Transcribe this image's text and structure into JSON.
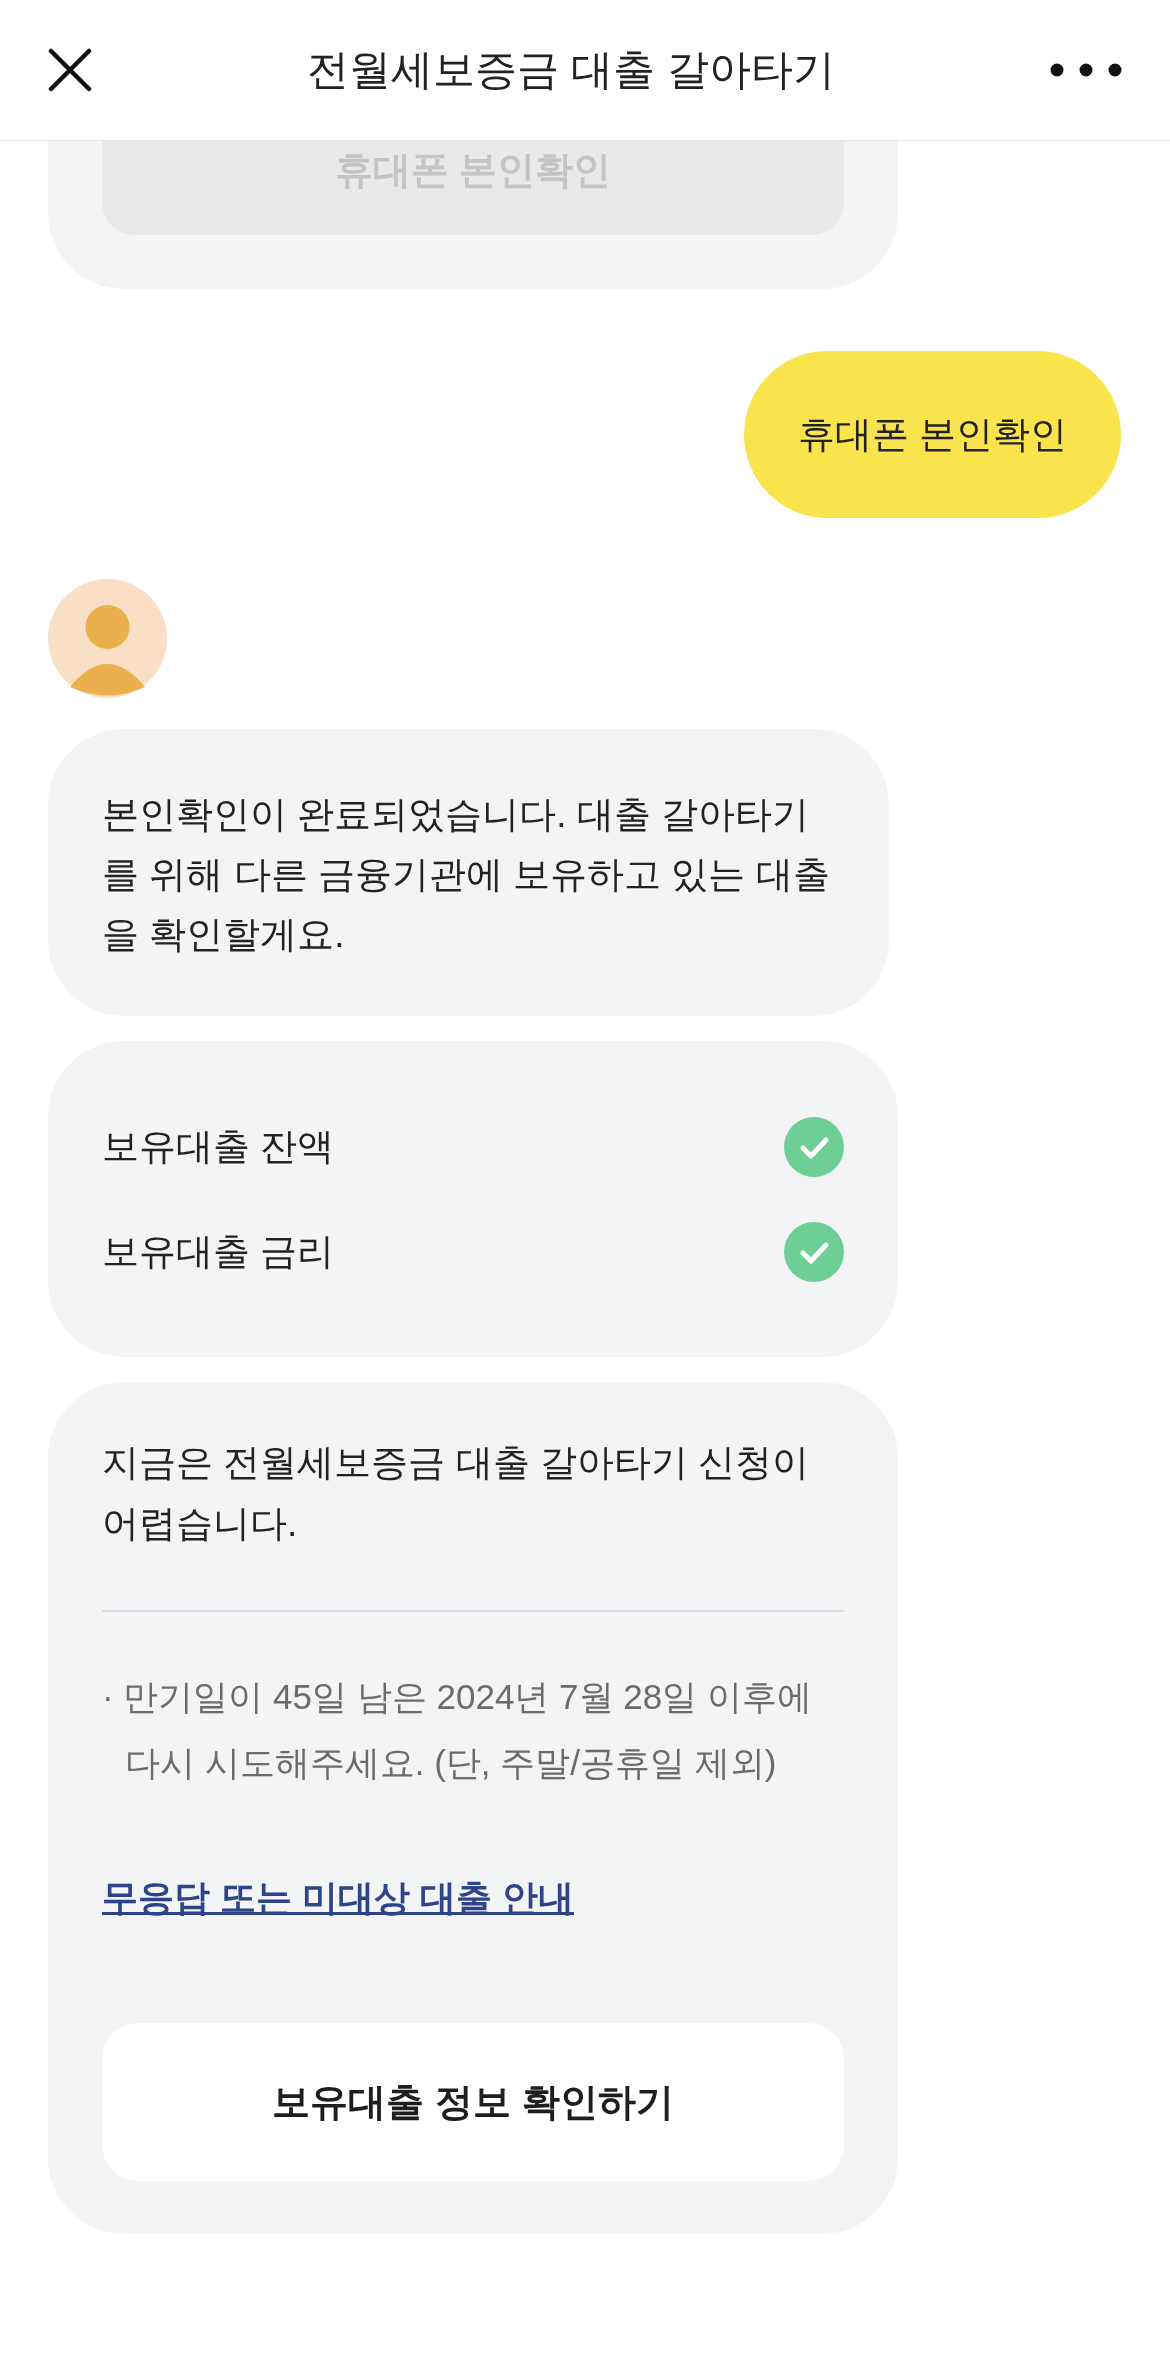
{
  "header": {
    "title": "전월세보증금 대출 갈아타기"
  },
  "messages": [
    {
      "kind": "bot_card",
      "button": {
        "label": "휴대폰 본인확인",
        "disabled": true
      }
    },
    {
      "kind": "user",
      "text": "휴대폰 본인확인"
    },
    {
      "kind": "avatar"
    },
    {
      "kind": "bot_text",
      "text": "본인확인이 완료되었습니다. 대출 갈아타기를 위해 다른 금융기관에 보유하고 있는 대출을 확인할게요."
    },
    {
      "kind": "checklist",
      "items": [
        {
          "label": "보유대출 잔액",
          "checked": true
        },
        {
          "label": "보유대출 금리",
          "checked": true
        }
      ]
    },
    {
      "kind": "notice",
      "text": "지금은 전월세보증금 대출 갈아타기 신청이 어렵습니다.",
      "note": "· 만기일이 45일 남은 2024년 7월 28일 이후에 다시 시도해주세요. (단, 주말/공휴일 제외)",
      "link": "무응답 또는 미대상 대출 안내",
      "button": "보유대출 정보 확인하기"
    }
  ]
}
